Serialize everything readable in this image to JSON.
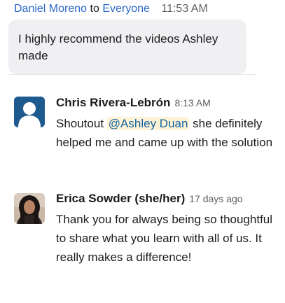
{
  "zoom_message": {
    "sender": "Daniel Moreno",
    "to_word": "to",
    "recipient": "Everyone",
    "time": "11:53 AM",
    "text": "I highly recommend the videos Ashley made"
  },
  "messages": [
    {
      "sender": "Chris Rivera-Lebrón",
      "time": "8:13 AM",
      "text_before": "Shoutout ",
      "mention": "@Ashley Duan",
      "text_after": " she definitely helped me and came up with the solution"
    },
    {
      "sender": "Erica Sowder (she/her)",
      "time": "17 days ago",
      "text": "Thank you for always being so thoughtful to share what you learn with all of us. It really makes a difference!"
    }
  ],
  "colors": {
    "link": "#2a68c9",
    "mention_bg": "#fef3d6",
    "mention_text": "#1264a3",
    "avatar_blue": "#1f5a8f",
    "bubble_bg": "#f0f0f3"
  }
}
